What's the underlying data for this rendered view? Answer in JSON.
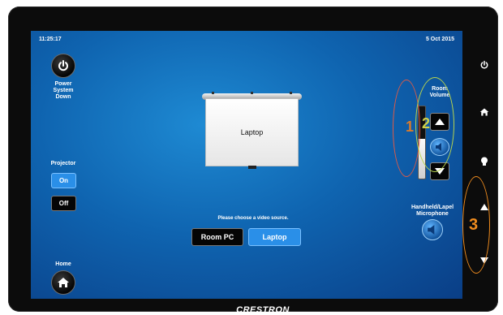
{
  "status": {
    "time": "11:25:17",
    "date": "5 Oct 2015"
  },
  "power": {
    "label_line1": "Power",
    "label_line2": "System",
    "label_line3": "Down",
    "icon": "power-icon"
  },
  "projector": {
    "heading": "Projector",
    "on_label": "On",
    "off_label": "Off",
    "state": "On"
  },
  "display": {
    "current_source": "Laptop"
  },
  "source_select": {
    "prompt": "Please choose a video source.",
    "options": [
      "Room PC",
      "Laptop"
    ],
    "selected": "Laptop"
  },
  "room_volume": {
    "label_line1": "Room",
    "label_line2": "Volume",
    "level": 0.55
  },
  "microphone": {
    "label_line1": "Handheld/Lapel",
    "label_line2": "Microphone",
    "icon": "speaker-icon"
  },
  "home": {
    "label": "Home",
    "icon": "home-icon"
  },
  "hardware_buttons": [
    "power-icon",
    "home-icon",
    "lightbulb-icon",
    "volume-up-icon",
    "volume-down-icon"
  ],
  "annotations": {
    "one": "1",
    "two": "2",
    "three": "3"
  },
  "brand": "CRESTRON",
  "colors": {
    "accent_blue": "#2a8fe8",
    "annotation_orange": "#f08c1e",
    "annotation_green": "#b7d44e",
    "annotation_red": "#e05a45"
  }
}
